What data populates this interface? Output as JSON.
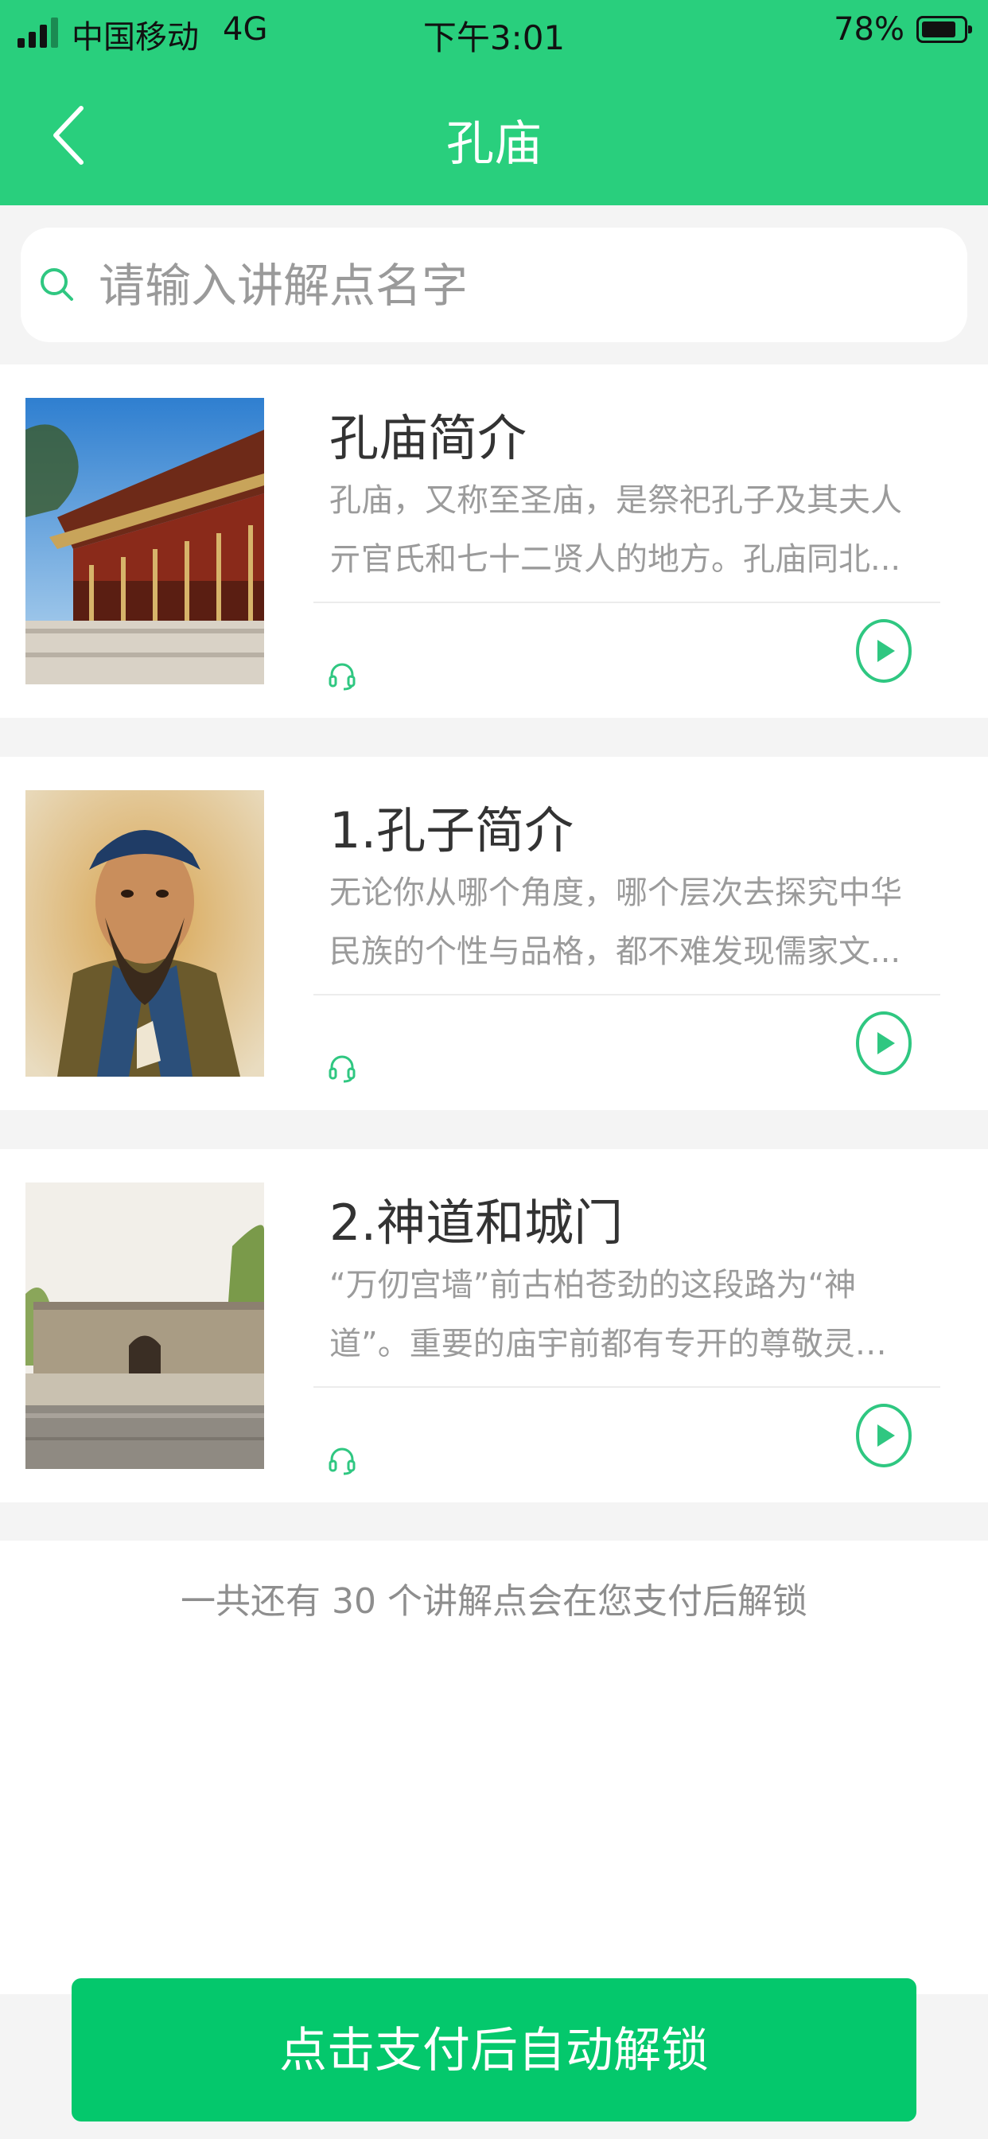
{
  "status_bar": {
    "carrier": "中国移动",
    "network": "4G",
    "time": "下午3:01",
    "battery": "78%"
  },
  "nav": {
    "title": "孔庙"
  },
  "search": {
    "placeholder": "请输入讲解点名字"
  },
  "items": [
    {
      "title": "孔庙简介",
      "description": "孔庙，又称至圣庙，是祭祀孔子及其夫人亓官氏和七十二贤人的地方。孔庙同北..."
    },
    {
      "title": "1.孔子简介",
      "description": "无论你从哪个角度，哪个层次去探究中华民族的个性与品格，都不难发现儒家文..."
    },
    {
      "title": "2.神道和城门",
      "description": "“万仞宫墙”前古柏苍劲的这段路为“神道”。重要的庙宇前都有专开的尊敬灵通之道..."
    }
  ],
  "unlock_note": "一共还有 30 个讲解点会在您支付后解锁",
  "pay_button": "点击支付后自动解锁",
  "colors": {
    "header": "#29cf7d",
    "accent": "#2fc781",
    "button": "#04c86c"
  },
  "icons": {
    "back": "chevron-left-icon",
    "search": "search-icon",
    "audio": "headphone-icon",
    "play": "play-circle-icon"
  }
}
